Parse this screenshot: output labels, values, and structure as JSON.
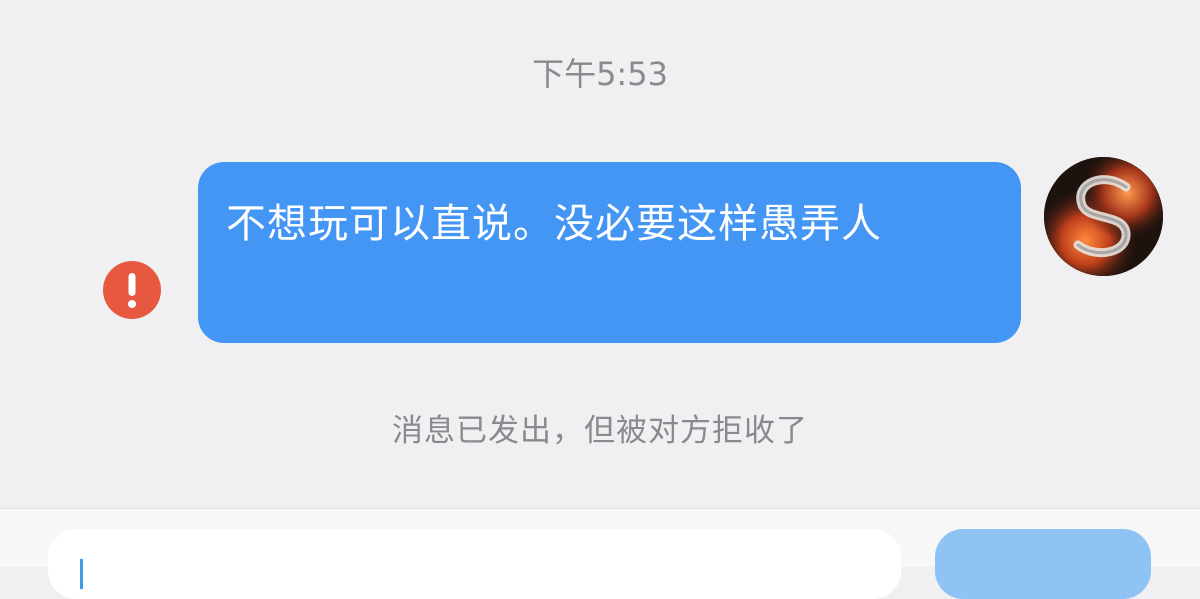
{
  "conversation": {
    "timestamp": "下午5:53",
    "messages": [
      {
        "direction": "outgoing",
        "text": "不想玩可以直说。没必要这样愚弄人",
        "status": "rejected",
        "bubble_color": "#4496f5"
      }
    ],
    "status_note": "消息已发出，但被对方拒收了"
  },
  "icons": {
    "error": "exclamation-circle-icon",
    "error_color": "#e65940",
    "avatar": "avatar-image"
  },
  "input_bar": {
    "message_value": "",
    "send_button_color": "#8fc3f3"
  }
}
